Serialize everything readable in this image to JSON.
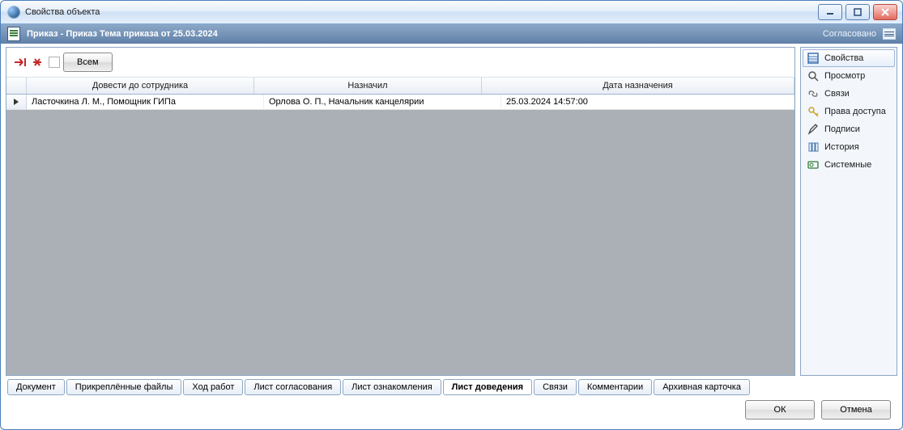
{
  "window": {
    "title": "Свойства объекта"
  },
  "document": {
    "caption": "Приказ - Приказ Тема приказа от 25.03.2024",
    "status": "Согласовано"
  },
  "toolbar": {
    "all_button": "Всем"
  },
  "grid": {
    "headers": {
      "employee": "Довести до сотрудника",
      "assigned_by": "Назначил",
      "assigned_at": "Дата назначения"
    },
    "rows": [
      {
        "employee": "Ласточкина Л. М., Помощник ГИПа",
        "assigned_by": "Орлова О. П., Начальник канцелярии",
        "assigned_at": "25.03.2024 14:57:00"
      }
    ]
  },
  "sidenav": {
    "items": [
      {
        "label": "Свойства",
        "icon": "properties"
      },
      {
        "label": "Просмотр",
        "icon": "search"
      },
      {
        "label": "Связи",
        "icon": "link"
      },
      {
        "label": "Права доступа",
        "icon": "key"
      },
      {
        "label": "Подписи",
        "icon": "pen"
      },
      {
        "label": "История",
        "icon": "history"
      },
      {
        "label": "Системные",
        "icon": "system"
      }
    ],
    "selected_index": 0
  },
  "tabs": {
    "items": [
      "Документ",
      "Прикреплённые файлы",
      "Ход работ",
      "Лист согласования",
      "Лист ознакомления",
      "Лист доведения",
      "Связи",
      "Комментарии",
      "Архивная карточка"
    ],
    "active_index": 5
  },
  "footer": {
    "ok": "ОК",
    "cancel": "Отмена"
  }
}
